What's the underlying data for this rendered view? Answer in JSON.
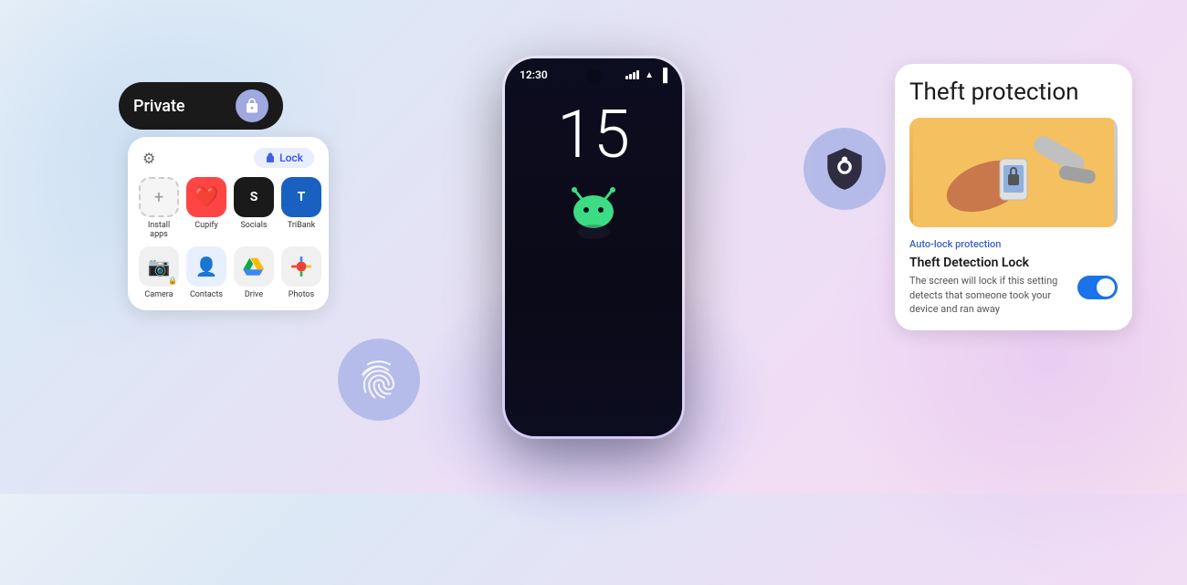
{
  "background": {
    "description": "Android 15 features promotional banner"
  },
  "left_panel": {
    "private_label": "Private",
    "lock_button_label": "Lock",
    "apps": [
      {
        "name": "Install apps",
        "icon": "+",
        "bg": "#f0f0f0"
      },
      {
        "name": "Cupify",
        "icon": "❤️",
        "bg": "#ff6060"
      },
      {
        "name": "Socials",
        "icon": "S",
        "bg": "#1a1a1a"
      },
      {
        "name": "TriBank",
        "icon": "T",
        "bg": "#2060a0"
      },
      {
        "name": "Camera",
        "icon": "📷",
        "bg": "#f0f0f0"
      },
      {
        "name": "Contacts",
        "icon": "👤",
        "bg": "#f0f0f0"
      },
      {
        "name": "Drive",
        "icon": "△",
        "bg": "#f0f0f0"
      },
      {
        "name": "Photos",
        "icon": "🌸",
        "bg": "#f0f0f0"
      }
    ]
  },
  "phone": {
    "time": "12:30",
    "number": "15"
  },
  "right_panel": {
    "title": "Theft protection",
    "auto_lock_label": "Auto-lock protection",
    "detection_title": "Theft Detection Lock",
    "detection_desc": "The screen will lock if this setting detects that someone took your device and ran away",
    "toggle_state": "on"
  },
  "icons": {
    "fingerprint": "⊙",
    "shield": "🛡",
    "gear": "⚙",
    "lock": "🔒",
    "check": "✓"
  }
}
